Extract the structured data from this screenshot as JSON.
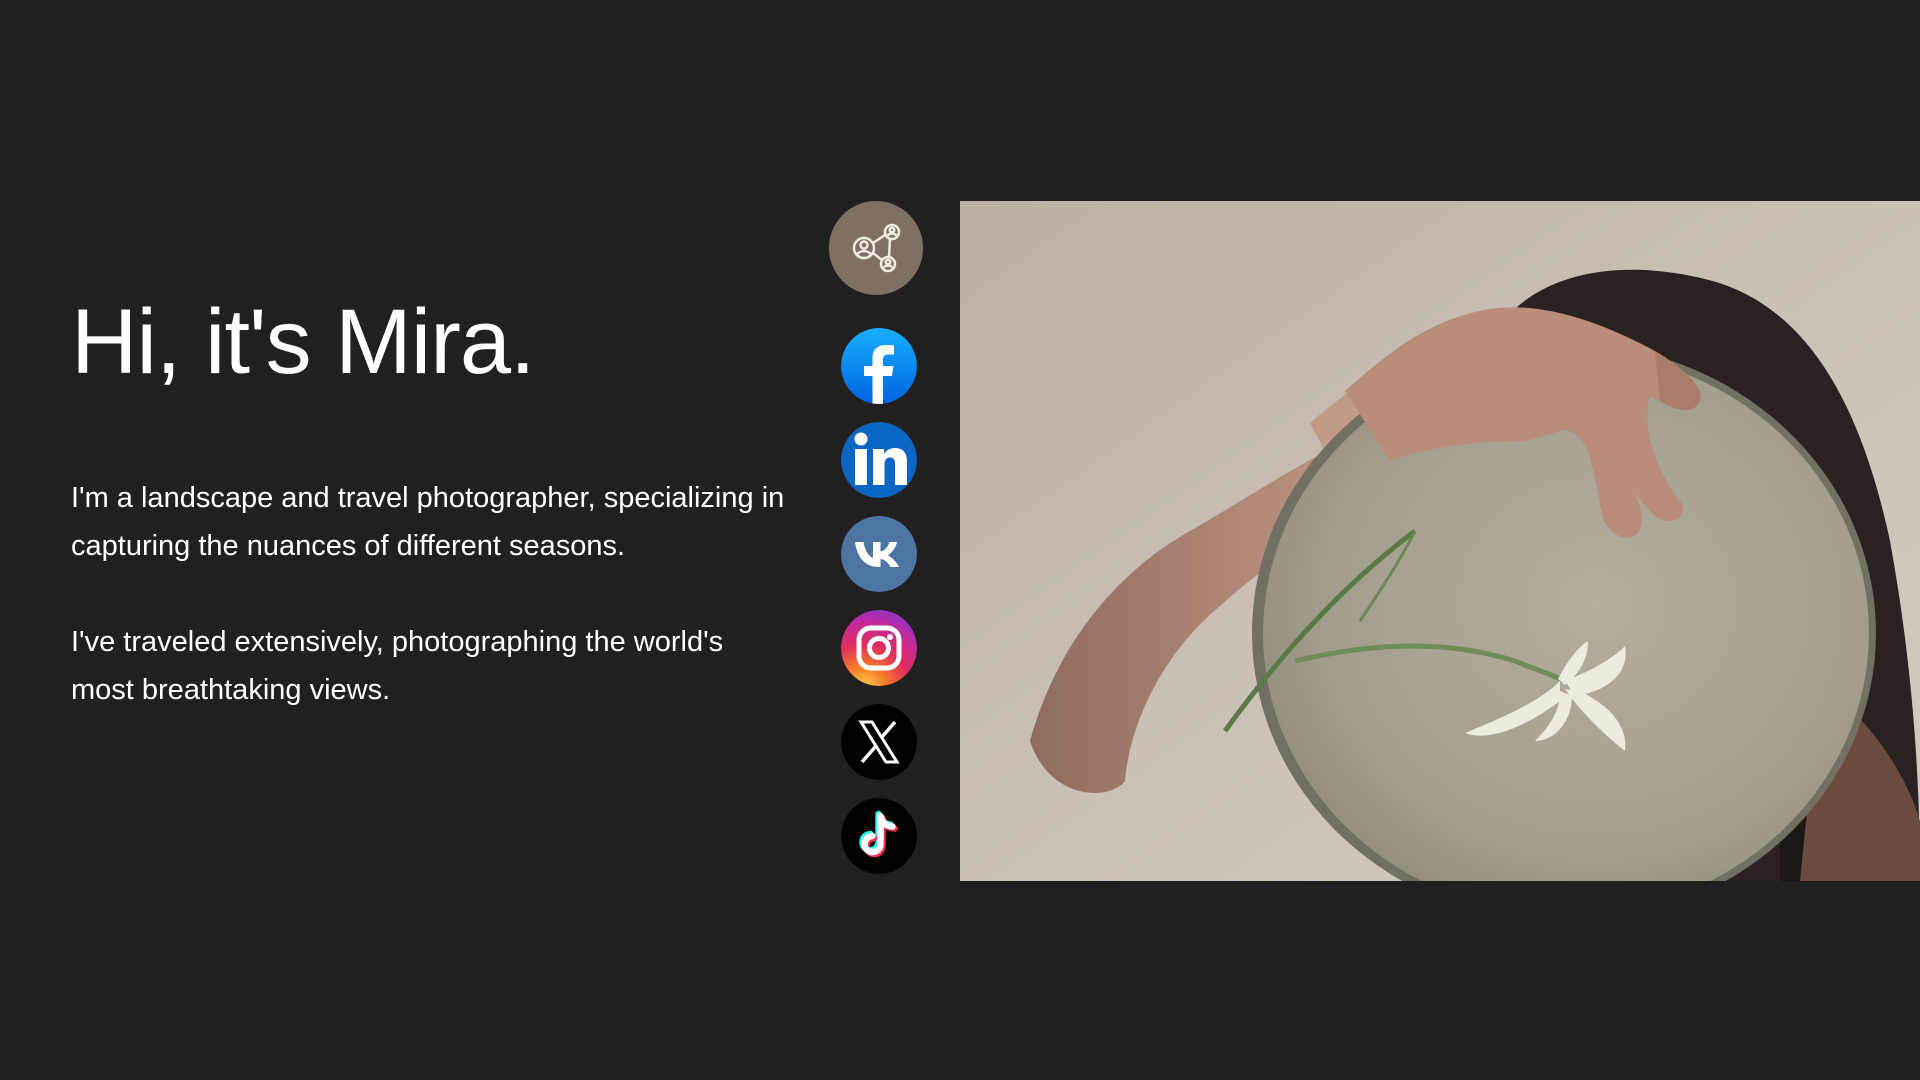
{
  "hero": {
    "title": "Hi, it's Mira.",
    "paragraphs": [
      "I'm a landscape and travel photographer, specializing in capturing the nuances of different seasons.",
      "I've traveled extensively, photographing the world's most breathtaking views."
    ]
  },
  "social": {
    "toggle_icon": "share-network-icon",
    "links": [
      {
        "name": "facebook-icon",
        "color": "#1877f2"
      },
      {
        "name": "linkedin-icon",
        "color": "#0a66c2"
      },
      {
        "name": "vk-icon",
        "color": "#4c75a3"
      },
      {
        "name": "instagram-icon",
        "color": "#e1306c"
      },
      {
        "name": "x-icon",
        "color": "#000000"
      },
      {
        "name": "tiktok-icon",
        "color": "#000000"
      }
    ]
  },
  "photo": {
    "icon": "portrait-photo-woman-mirror-flower"
  },
  "colors": {
    "background": "#221f20",
    "text": "#ffffff",
    "accent": "#7e7163"
  }
}
